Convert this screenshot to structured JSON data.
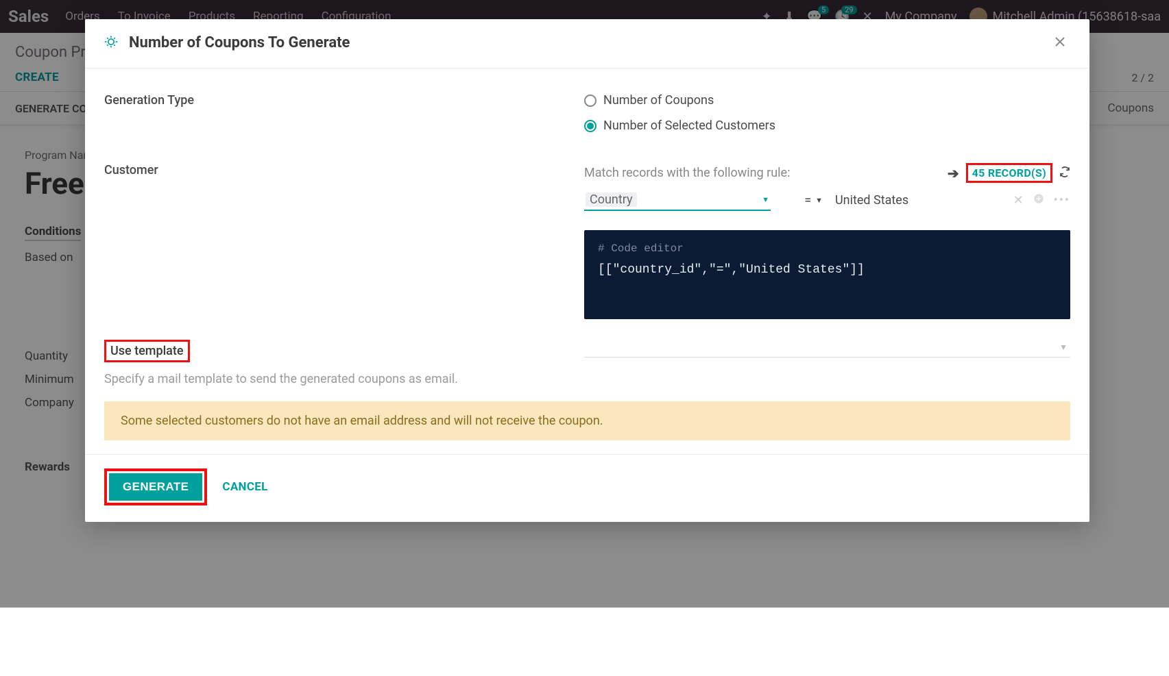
{
  "topnav": {
    "brand": "Sales",
    "items": [
      "Orders",
      "To Invoice",
      "Products",
      "Reporting",
      "Configuration"
    ],
    "msg_badge": "5",
    "call_badge": "29",
    "company": "My Company",
    "user": "Mitchell Admin (15638618-saa"
  },
  "subheader": {
    "breadcrumb": "Coupon Programs",
    "create": "CREATE",
    "pager": "2 / 2"
  },
  "statusbar": {
    "gen_coupon": "GENERATE COUPON",
    "coupons_link": "Coupons"
  },
  "form": {
    "pname_label": "Program Name",
    "pname": "Free",
    "conditions_title": "Conditions",
    "based_on": "Based on",
    "quantity": "Quantity",
    "minimum": "Minimum",
    "company": "Company",
    "rewards": "Rewards"
  },
  "modal": {
    "title": "Number of Coupons To Generate",
    "gen_type_label": "Generation Type",
    "radio_coupons": "Number of Coupons",
    "radio_customers": "Number of Selected Customers",
    "customer_label": "Customer",
    "match_text": "Match records with the following rule:",
    "records_count": "45 RECORD(S)",
    "domain_field": "Country",
    "domain_op": "=",
    "domain_value": "United States",
    "code_comment": "# Code editor",
    "code_body": "[[\"country_id\",\"=\",\"United States\"]]",
    "template_label": "Use template",
    "template_hint": "Specify a mail template to send the generated coupons as email.",
    "warning": "Some selected customers do not have an email address and will not receive the coupon.",
    "generate_btn": "GENERATE",
    "cancel_btn": "CANCEL"
  }
}
